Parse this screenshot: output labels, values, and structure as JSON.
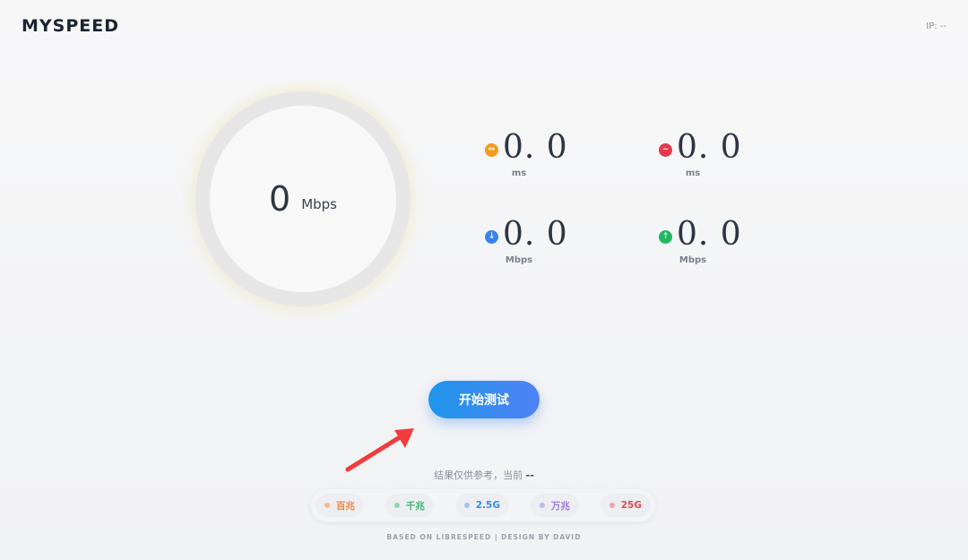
{
  "header": {
    "logo": "MYSPEED",
    "ip_label": "IP: --"
  },
  "gauge": {
    "value": "0",
    "unit": "Mbps"
  },
  "metrics": {
    "ping": {
      "value": "0. 0",
      "unit": "ms",
      "icon": "ping-icon",
      "color": "#f29b1d"
    },
    "jitter": {
      "value": "0. 0",
      "unit": "ms",
      "icon": "jitter-icon",
      "color": "#e5374e"
    },
    "download": {
      "value": "0. 0",
      "unit": "Mbps",
      "icon": "download-icon",
      "color": "#3a82f0"
    },
    "upload": {
      "value": "0. 0",
      "unit": "Mbps",
      "icon": "upload-icon",
      "color": "#22b862"
    }
  },
  "start_button": {
    "label": "开始测试"
  },
  "note": {
    "text": "结果仅供参考，当前",
    "current": "--"
  },
  "speed_tiers": [
    {
      "label": "百兆",
      "dot_color": "#f4b88a",
      "text_color": "#e9884a"
    },
    {
      "label": "千兆",
      "dot_color": "#8fd9b0",
      "text_color": "#3cb372"
    },
    {
      "label": "2.5G",
      "dot_color": "#9ec6f0",
      "text_color": "#3a8ae0"
    },
    {
      "label": "万兆",
      "dot_color": "#c7b3f0",
      "text_color": "#9b7be0"
    },
    {
      "label": "25G",
      "dot_color": "#f0a3a8",
      "text_color": "#e04a55"
    }
  ],
  "footer": {
    "text": "BASED ON LIBRESPEED | DESIGN BY DAVID"
  }
}
